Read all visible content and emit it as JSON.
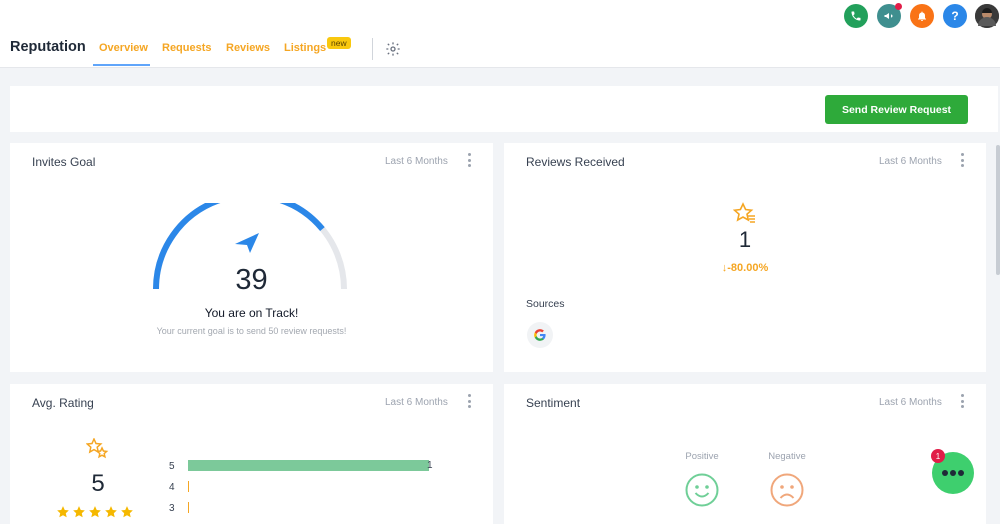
{
  "header": {
    "title": "Reputation",
    "tabs": [
      {
        "label": "Overview",
        "active": true
      },
      {
        "label": "Requests"
      },
      {
        "label": "Reviews"
      },
      {
        "label": "Listings"
      }
    ],
    "new_badge": "new"
  },
  "topbar_icons": [
    {
      "name": "phone-icon",
      "color": "#22a05b"
    },
    {
      "name": "megaphone-icon",
      "color": "#3f8f8f"
    },
    {
      "name": "bell-icon",
      "color": "#f97316"
    },
    {
      "name": "help-icon",
      "color": "#2b87e8",
      "glyph": "?"
    },
    {
      "name": "avatar"
    }
  ],
  "actions": {
    "send_review_request": "Send Review Request"
  },
  "invites_goal": {
    "title": "Invites Goal",
    "period": "Last 6 Months",
    "value": "39",
    "status": "You are on Track!",
    "subtext": "Your current goal is to send 50 review requests!",
    "progress_fraction": 0.78
  },
  "reviews_received": {
    "title": "Reviews Received",
    "period": "Last 6 Months",
    "count": "1",
    "change": "-80.00%",
    "sources_label": "Sources"
  },
  "avg_rating": {
    "title": "Avg. Rating",
    "period": "Last 6 Months",
    "value": "5",
    "stars": 5,
    "breakdown": [
      {
        "label": "5",
        "count": "1",
        "fraction": 1.0
      },
      {
        "label": "4",
        "fraction": 0
      },
      {
        "label": "3",
        "fraction": 0
      }
    ]
  },
  "sentiment": {
    "title": "Sentiment",
    "period": "Last 6 Months",
    "positive_label": "Positive",
    "negative_label": "Negative"
  },
  "chat": {
    "badge": "1"
  },
  "colors": {
    "accent_orange": "#f5a623",
    "gauge_blue": "#2b87e8",
    "bar_green": "#7cc99a",
    "positive_green": "#6fcf97",
    "negative_orange": "#f0a77b",
    "send_green": "#2eaa3a"
  }
}
